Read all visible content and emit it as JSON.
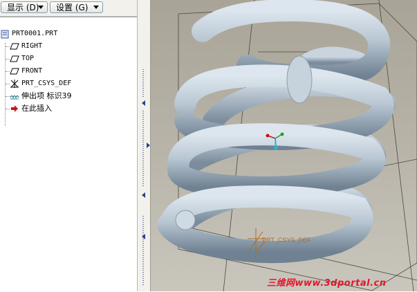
{
  "toolbar": {
    "show_menu_label": "显示 (D)",
    "settings_menu_label": "设置 (G)"
  },
  "tree": {
    "part_name": "PRT0001.PRT",
    "items": [
      {
        "label": "RIGHT",
        "icon": "datum-plane-icon"
      },
      {
        "label": "TOP",
        "icon": "datum-plane-icon"
      },
      {
        "label": "FRONT",
        "icon": "datum-plane-icon"
      },
      {
        "label": "PRT_CSYS_DEF",
        "icon": "coordinate-system-icon"
      },
      {
        "label": "伸出项  标识39",
        "icon": "sweep-protrusion-icon"
      },
      {
        "label": "在此插入",
        "icon": "insert-here-arrow-icon"
      }
    ]
  },
  "viewport": {
    "csys_label": "PRT_CSYS_DEF",
    "watermark": "三维网www.3dportal.cn",
    "model_color": "#b8c6d2",
    "background_color": "#b3afa4"
  }
}
